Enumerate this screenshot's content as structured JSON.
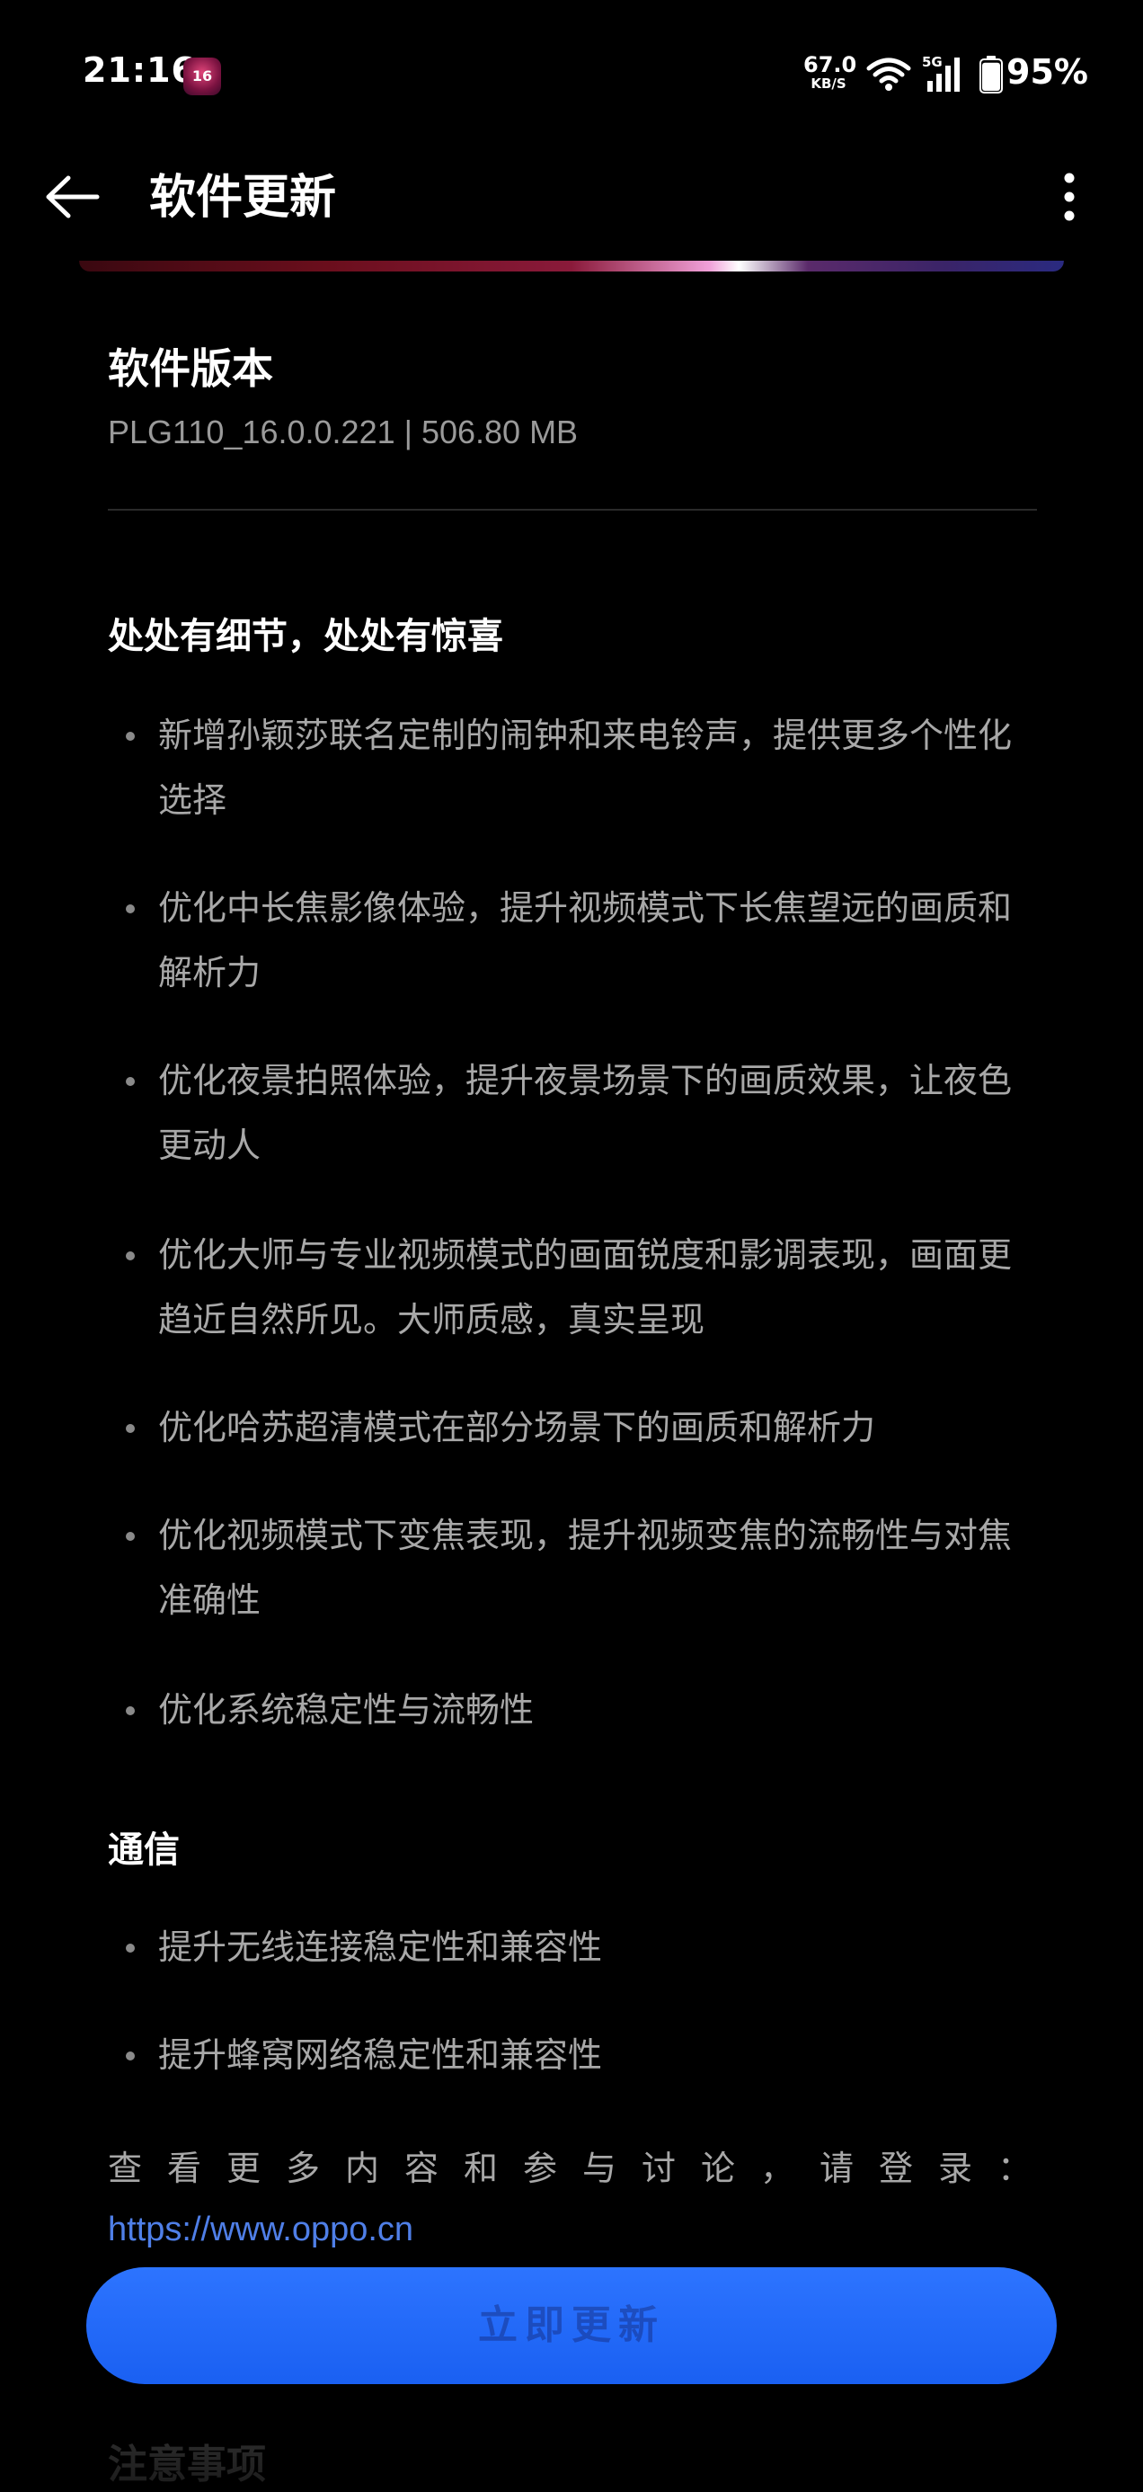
{
  "status_bar": {
    "time": "21:16",
    "app_badge": "16",
    "net_speed_value": "67.0",
    "net_speed_unit": "KB/S",
    "signal_label": "5G",
    "battery_percent": "95%",
    "battery_level": 0.95
  },
  "header": {
    "title": "软件更新",
    "back_icon": "arrow-left-icon",
    "more_icon": "more-vertical-icon"
  },
  "version": {
    "label": "软件版本",
    "info": "PLG110_16.0.0.221 | 506.80 MB"
  },
  "sections": [
    {
      "title": "处处有细节，处处有惊喜",
      "items": [
        "新增孙颖莎联名定制的闹钟和来电铃声，提供更多个性化选择",
        "优化中长焦影像体验，提升视频模式下长焦望远的画质和解析力",
        "优化夜景拍照体验，提升夜景场景下的画质效果，让夜色更动人",
        "优化大师与专业视频模式的画面锐度和影调表现，画面更趋近自然所见。大师质感，真实呈现",
        "优化哈苏超清模式在部分场景下的画质和解析力",
        "优化视频模式下变焦表现，提升视频变焦的流畅性与对焦准确性",
        "优化系统稳定性与流畅性"
      ]
    },
    {
      "title": "通信",
      "items": [
        "提升无线连接稳定性和兼容性",
        "提升蜂窝网络稳定性和兼容性"
      ]
    }
  ],
  "more": {
    "text": "查看更多内容和参与讨论，请登录：",
    "link": "https://www.oppo.cn"
  },
  "action_button": {
    "label": "立即更新"
  },
  "notes": {
    "title": "注意事项"
  },
  "colors": {
    "background": "#000000",
    "accent": "#1a60f2",
    "link": "#4f7fe8",
    "body_text": "#a8a8a8"
  }
}
